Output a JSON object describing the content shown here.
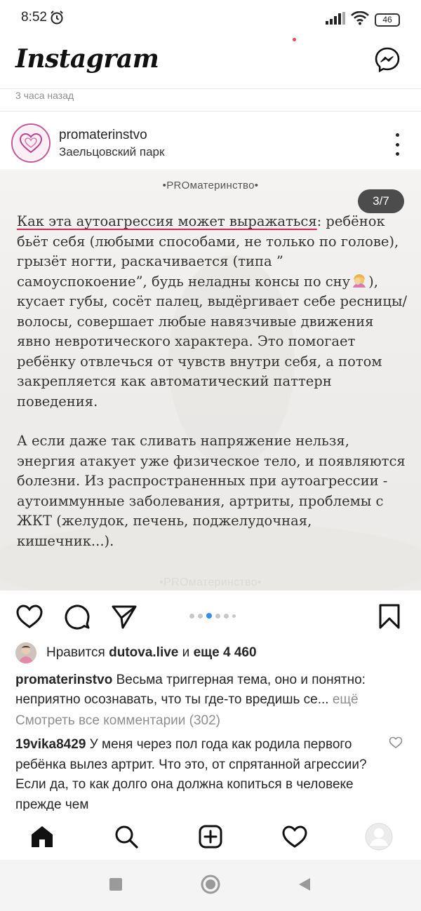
{
  "status_bar": {
    "time": "8:52",
    "battery": "46"
  },
  "header": {
    "app_name": "Instagram"
  },
  "prev_post": {
    "timestamp": "3 часа назад"
  },
  "post": {
    "username": "promaterinstvo",
    "location": "Заельцовский парк",
    "slide_counter": "3/7",
    "watermark_top": "•PROматеринство•",
    "watermark_bottom": "•PROматеринство•",
    "text_heading": "Как эта аутоагрессия может выражаться",
    "text_para1_rest_a": ": ребёнок бьёт себя (любыми способами, не только по голове), грызёт ногти, раскачивается (типа ” самоуспокоение”, будь неладны консы по сну",
    "text_para1_rest_b": "), кусает губы, сосёт палец, выдёргивает себе ресницы/волосы, совершает любые навязчивые движения явно невротического характера. Это помогает ребёнку отвлечься от чувств внутри себя, а потом закрепляется как автоматический паттерн поведения.",
    "text_para2": "А если даже так сливать напряжение нельзя, энергия атакует уже физическое тело, и появляются болезни. Из распространенных при аутоагрессии - аутоиммунные заболевания, артриты, проблемы с ЖКТ (желудок, печень, поджелудочная, кишечник...).",
    "emoji_name": "woman-facepalming-emoji",
    "carousel": {
      "total_dots": 6,
      "active_index": 2
    }
  },
  "likes": {
    "prefix": "Нравится",
    "liker": "dutova.live",
    "connector": "и",
    "others": "еще 4 460"
  },
  "caption": {
    "username": "promaterinstvo",
    "text": "Весьма триггерная тема, оно и понятно: неприятно осознавать, что ты где-то вредишь се...",
    "more": "ещё"
  },
  "comments": {
    "view_all": "Смотреть все комментарии (302)",
    "first": {
      "username": "19vika8429",
      "text": "У меня через пол года как родила первого ребёнка вылез артрит. Что это, от спрятанной агрессии? Если да, то как долго она должна копиться в человеке прежде чем"
    }
  },
  "bottom_nav": {
    "items": [
      "home-icon",
      "search-icon",
      "new-post-icon",
      "activity-icon",
      "profile-icon"
    ]
  },
  "colors": {
    "accent_blue": "#2f8ef5",
    "underline_red": "#d3254f",
    "notification_red": "#ed4956"
  }
}
